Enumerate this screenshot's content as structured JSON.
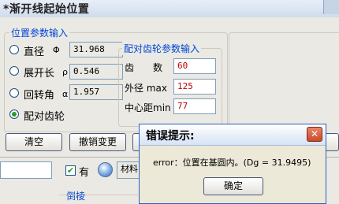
{
  "window": {
    "title": "*渐开线起始位置",
    "close_symbol": ""
  },
  "position_group": {
    "legend": "位置参数输入",
    "options": [
      {
        "label": "直径",
        "symbol": "Φ",
        "value": "31.968",
        "checked": false
      },
      {
        "label": "展开长",
        "symbol": "ρ",
        "value": "0.546",
        "checked": false
      },
      {
        "label": "回转角",
        "symbol": "α",
        "value": "1.957",
        "checked": false
      },
      {
        "label": "配对齿轮",
        "symbol": "",
        "value": "",
        "checked": true
      }
    ]
  },
  "mating_group": {
    "legend": "配对齿轮参数输入",
    "fields": [
      {
        "label": "齿　　数",
        "value": "60"
      },
      {
        "label": "外径 max",
        "value": "125"
      },
      {
        "label": "中心距min",
        "value": "77"
      }
    ]
  },
  "buttons": {
    "clear": "清空",
    "undo": "撤销变更"
  },
  "bottom": {
    "checkbox_label": "有",
    "material_label": "材料",
    "chamfer_label": "倒棱"
  },
  "dialog": {
    "title": "错误提示:",
    "message": "error：位置在基圆内。(Dg = 31.9495)",
    "ok": "确定",
    "close_symbol": "✕"
  }
}
